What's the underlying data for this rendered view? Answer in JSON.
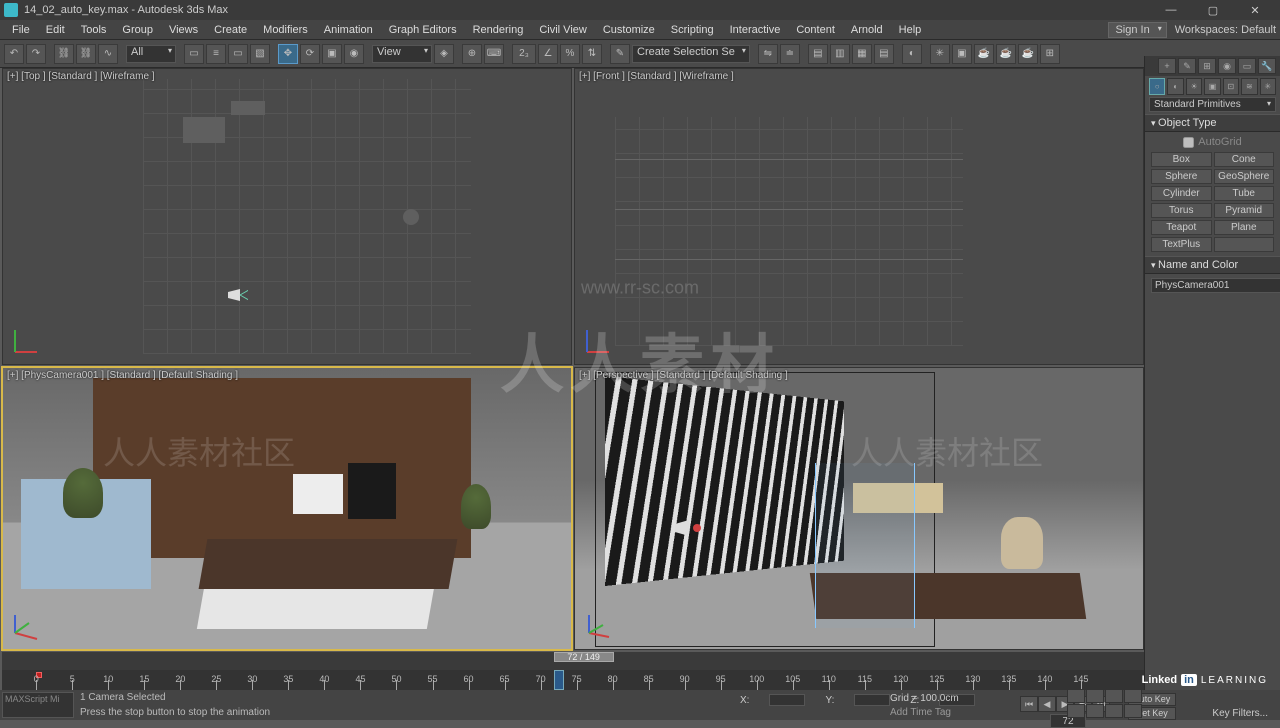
{
  "title_bar": {
    "filename": "14_02_auto_key.max - Autodesk 3ds Max"
  },
  "menu": {
    "items": [
      "File",
      "Edit",
      "Tools",
      "Group",
      "Views",
      "Create",
      "Modifiers",
      "Animation",
      "Graph Editors",
      "Rendering",
      "Civil View",
      "Customize",
      "Scripting",
      "Interactive",
      "Content",
      "Arnold",
      "Help"
    ],
    "signin": "Sign In",
    "workspace_label": "Workspaces:",
    "workspace_value": "Default"
  },
  "toolbar": {
    "selector_all": "All",
    "selector_view": "View",
    "create_sel": "Create Selection Se"
  },
  "viewports": {
    "top": "[+] [Top ] [Standard ] [Wireframe ]",
    "front": "[+] [Front ] [Standard ] [Wireframe ]",
    "camera": "[+] [PhysCamera001 ] [Standard ] [Default Shading ]",
    "persp": "[+] [Perspective ] [Standard ] [Default Shading ]"
  },
  "track": {
    "thumb": "72 / 149"
  },
  "timeline": {
    "start": 0,
    "end": 149,
    "major": 5,
    "current": 72,
    "keys": [
      0
    ]
  },
  "cmd": {
    "dropdown": "Standard Primitives",
    "rollout_type": "Object Type",
    "autogrid": "AutoGrid",
    "prims": [
      "Box",
      "Cone",
      "Sphere",
      "GeoSphere",
      "Cylinder",
      "Tube",
      "Torus",
      "Pyramid",
      "Teapot",
      "Plane",
      "TextPlus",
      ""
    ],
    "rollout_name": "Name and Color",
    "obj_name": "PhysCamera001"
  },
  "status": {
    "selection": "1 Camera Selected",
    "prompt_label": "MAXScript Mi",
    "prompt": "Press the stop button to stop the animation",
    "x": "X:",
    "y": "Y:",
    "z": "Z:",
    "grid": "Grid = 100.0cm",
    "add_tag": "Add Time Tag",
    "frame": "72",
    "autokey": "Auto Key",
    "setkey": "Set Key",
    "keyfilters": "Key Filters..."
  },
  "watermark": {
    "big": "人人素材",
    "url": "www.rr-sc.com",
    "tag": "人人素材社区"
  },
  "linkedin": {
    "brand": "Linked",
    "in": "in",
    "learn": "LEARNING"
  }
}
